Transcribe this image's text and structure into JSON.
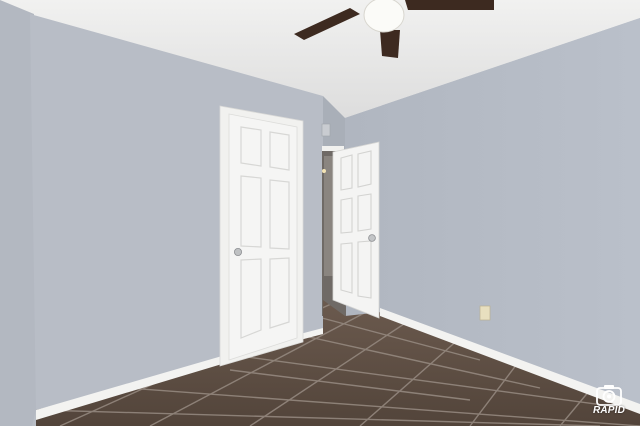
{
  "photo": {
    "subject": "empty-bedroom-interior",
    "objects": [
      "ceiling-fan",
      "closet-door",
      "bedroom-door",
      "hallway",
      "tile-floor",
      "baseboards",
      "electrical-outlet",
      "air-vent"
    ],
    "colors": {
      "wall_left": "#b8bdc6",
      "wall_back": "#aeb4bd",
      "wall_right": "#b4bac4",
      "ceiling": "#ebebea",
      "floor": "#5e4f44",
      "grout": "#9a8f86",
      "door": "#f3f3f2",
      "trim": "#f5f5f3",
      "fan_blade": "#3e2a20"
    }
  },
  "watermark": {
    "text": "RAPID",
    "icon": "camera-icon"
  }
}
